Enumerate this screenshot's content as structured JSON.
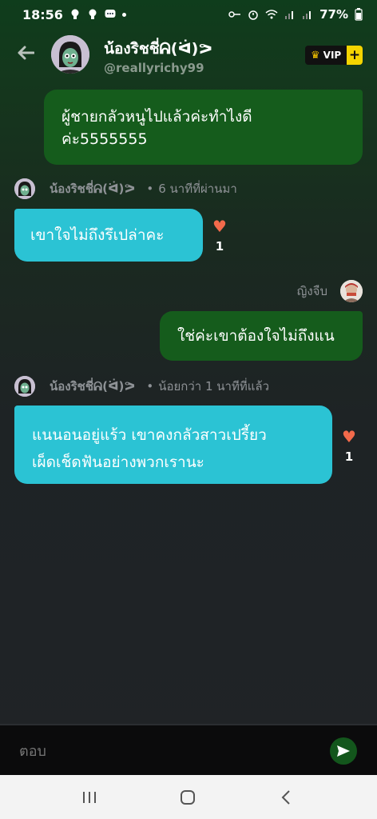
{
  "status_bar": {
    "time": "18:56",
    "battery": "77%",
    "icons": [
      "bulb-icon",
      "bulb-icon",
      "chat-icon",
      "dot-icon",
      "key-icon",
      "alarm-icon",
      "wifi-icon",
      "signal-icon",
      "signal-icon",
      "battery-icon"
    ]
  },
  "header": {
    "name": "น้องริชชี่ᕱ(ᐛ)ᕗ",
    "handle": "@reallyrichy99",
    "vip_label": "VIP",
    "vip_plus": "+"
  },
  "messages": [
    {
      "direction": "outgoing",
      "text_line1": "ผู้ชายกลัวหนูไปแล้วค่ะทำไงดี",
      "text_line2": "ค่ะ5555555"
    },
    {
      "direction": "incoming",
      "sender": "น้องริชชี่ᕱ(ᐛ)ᕗ",
      "time": "6 นาทีที่ผ่านมา",
      "text": "เขาใจไม่ถึงรึเปล่าคะ",
      "likes": "1"
    },
    {
      "direction": "outgoing",
      "sender": "ญิงจืบ",
      "text": "ใช่ค่ะเขาต้องใจไม่ถึงแน"
    },
    {
      "direction": "incoming",
      "sender": "น้องริชชี่ᕱ(ᐛ)ᕗ",
      "time": "น้อยกว่า 1 นาทีที่แล้ว",
      "text_line1": "แนนอนอยู่แร้ว เขาคงกลัวสาวเปรี้ยว",
      "text_line2": "เผ็ดเช็ดฟันอย่างพวกเรานะ",
      "likes": "1"
    }
  ],
  "separator": "•",
  "reply": {
    "placeholder": "ตอบ"
  },
  "colors": {
    "outgoing_bubble": "#155c1c",
    "incoming_bubble": "#2bc3d4",
    "heart": "#f26a4b",
    "vip_plus": "#f5d400"
  }
}
